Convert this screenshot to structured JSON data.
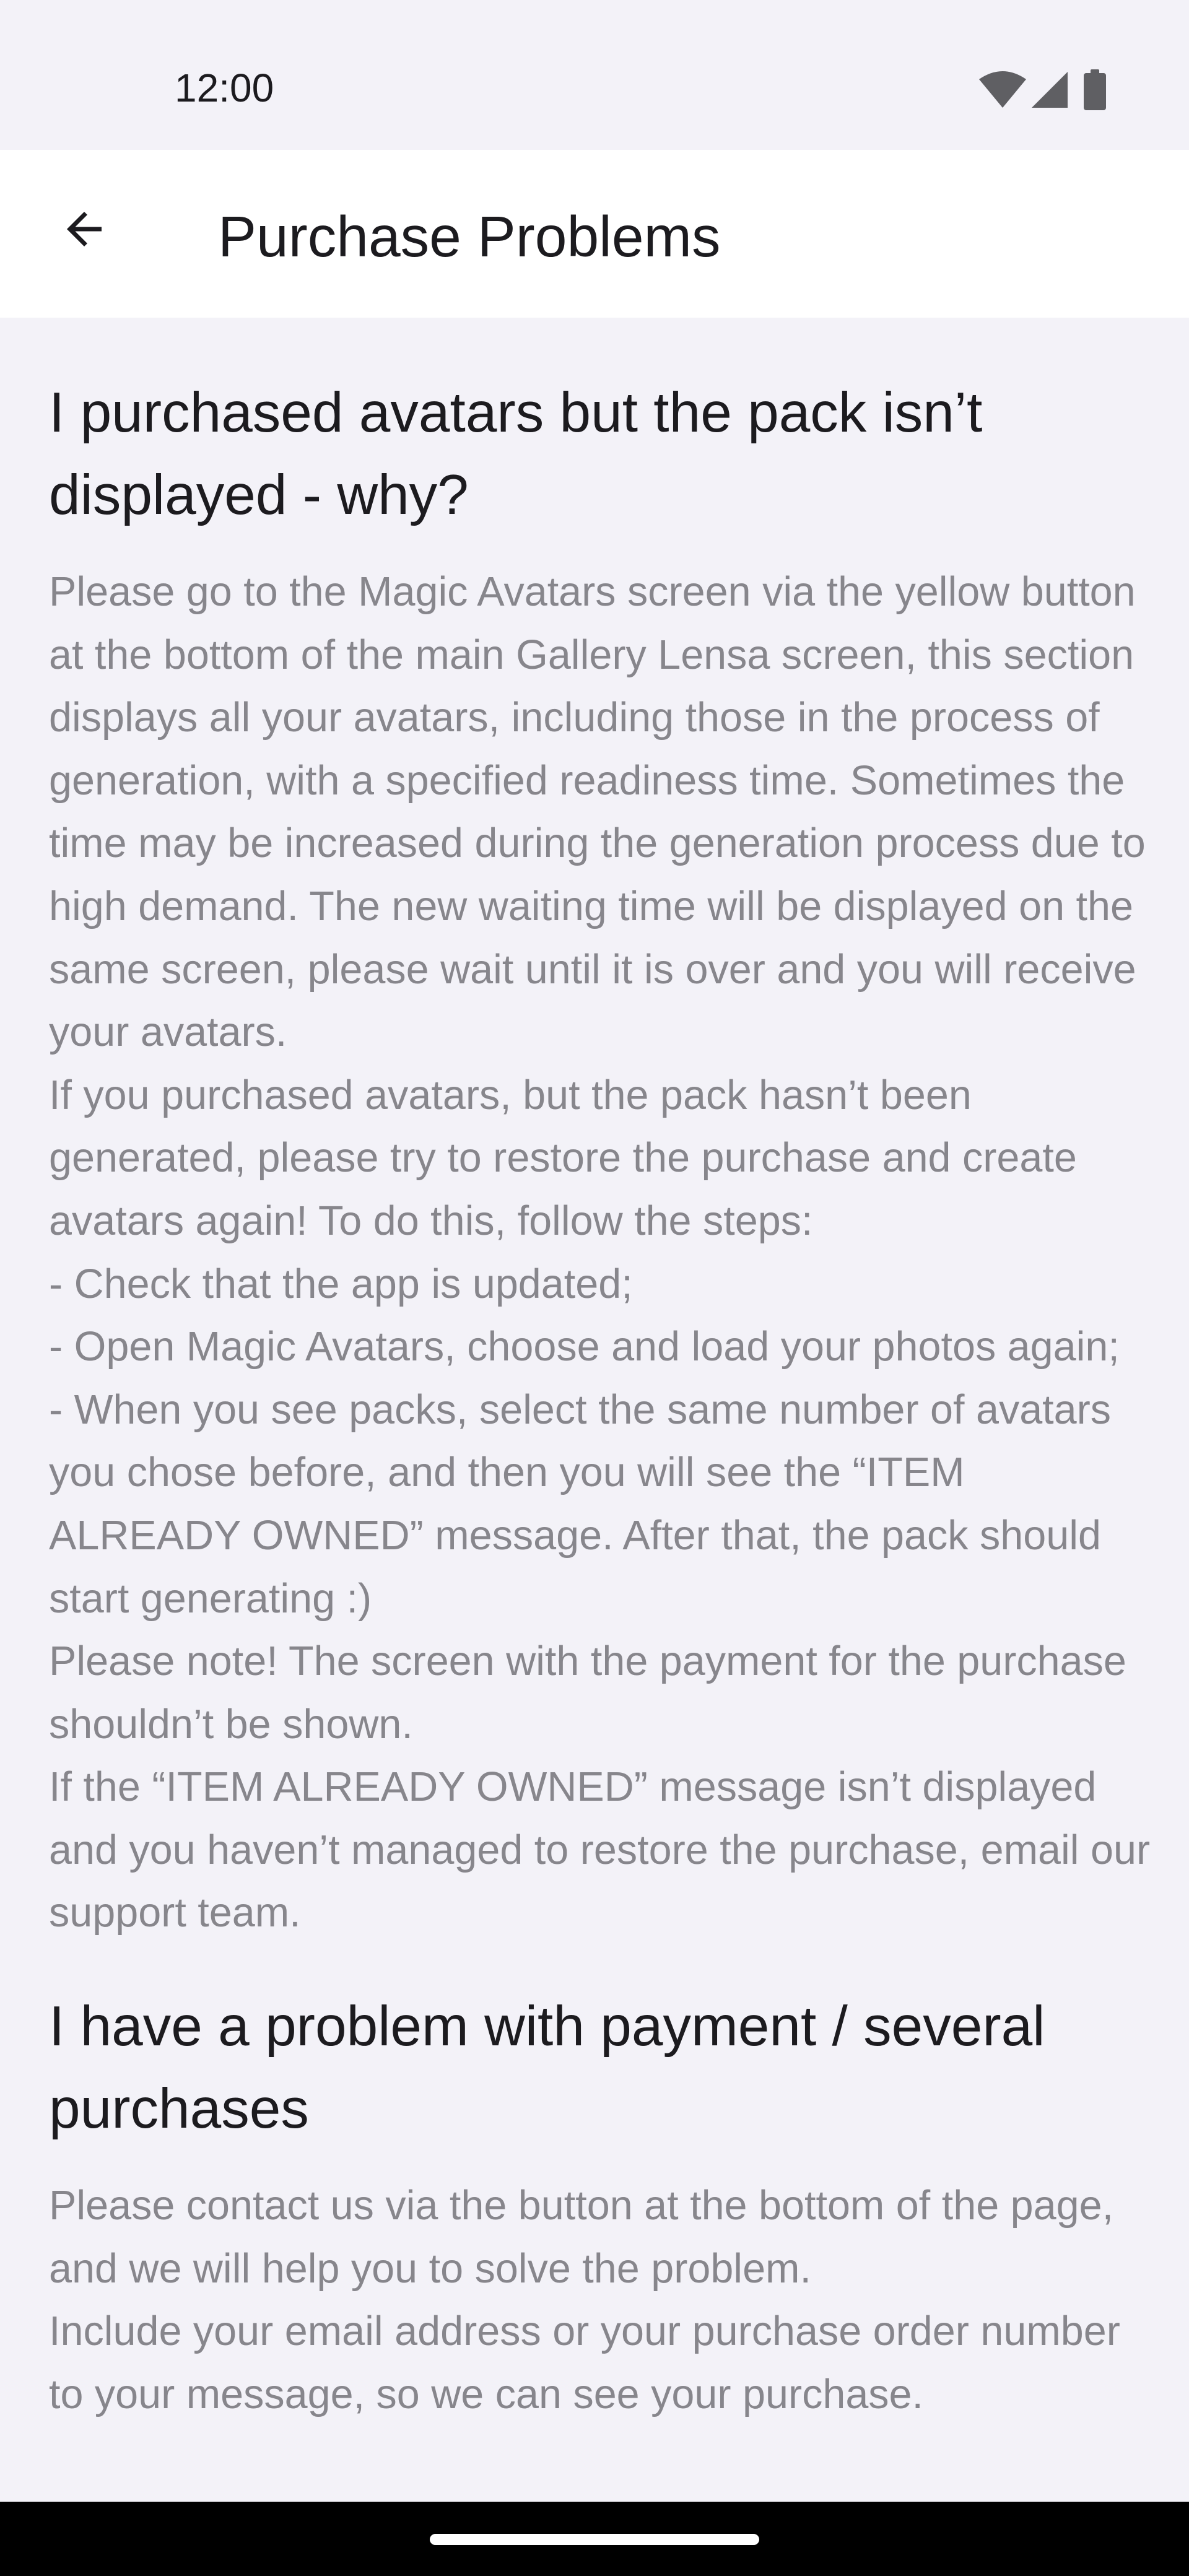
{
  "status_bar": {
    "time": "12:00",
    "icons": [
      "wifi-icon",
      "cellular-signal-icon",
      "battery-icon"
    ]
  },
  "app_bar": {
    "back_icon": "arrow-back-icon",
    "title": "Purchase Problems"
  },
  "sections": [
    {
      "question": "I purchased avatars but the pack isn’t displayed - why?",
      "answer": [
        "Please go to the Magic Avatars screen via the yellow button at the bottom of the main Gallery Lensa screen, this section displays all your avatars, including those in the process of generation, with a specified readiness time. Sometimes the time may be increased during the generation process due to high demand. The new waiting time will be displayed on the same screen, please wait until it is over and you will receive your avatars.",
        "If you purchased avatars, but the pack hasn’t been generated, please try to restore the purchase and create avatars again! To do this, follow the steps:",
        "- Check that the app is updated;",
        "- Open Magic Avatars, choose and load your photos again;",
        "- When you see packs, select the same number of avatars you chose before, and then you will see the “ITEM ALREADY OWNED” message. After that, the pack should start generating :)",
        "Please note! The screen with the payment for the purchase shouldn’t be shown.",
        "If the “ITEM ALREADY OWNED” message isn’t displayed and you haven’t managed to restore the purchase, email our support team."
      ]
    },
    {
      "question": "I have a problem with payment / several purchases",
      "answer": [
        "Please contact us via the button at the bottom of the page, and we will help you to solve the problem.",
        "Include your email address or your purchase order number to your message, so we can see your purchase."
      ]
    }
  ],
  "colors": {
    "background": "#f3f2f8",
    "app_bar": "#ffffff",
    "heading_text": "#1c1b1f",
    "body_text": "#87868c",
    "nav_bar": "#000000"
  }
}
